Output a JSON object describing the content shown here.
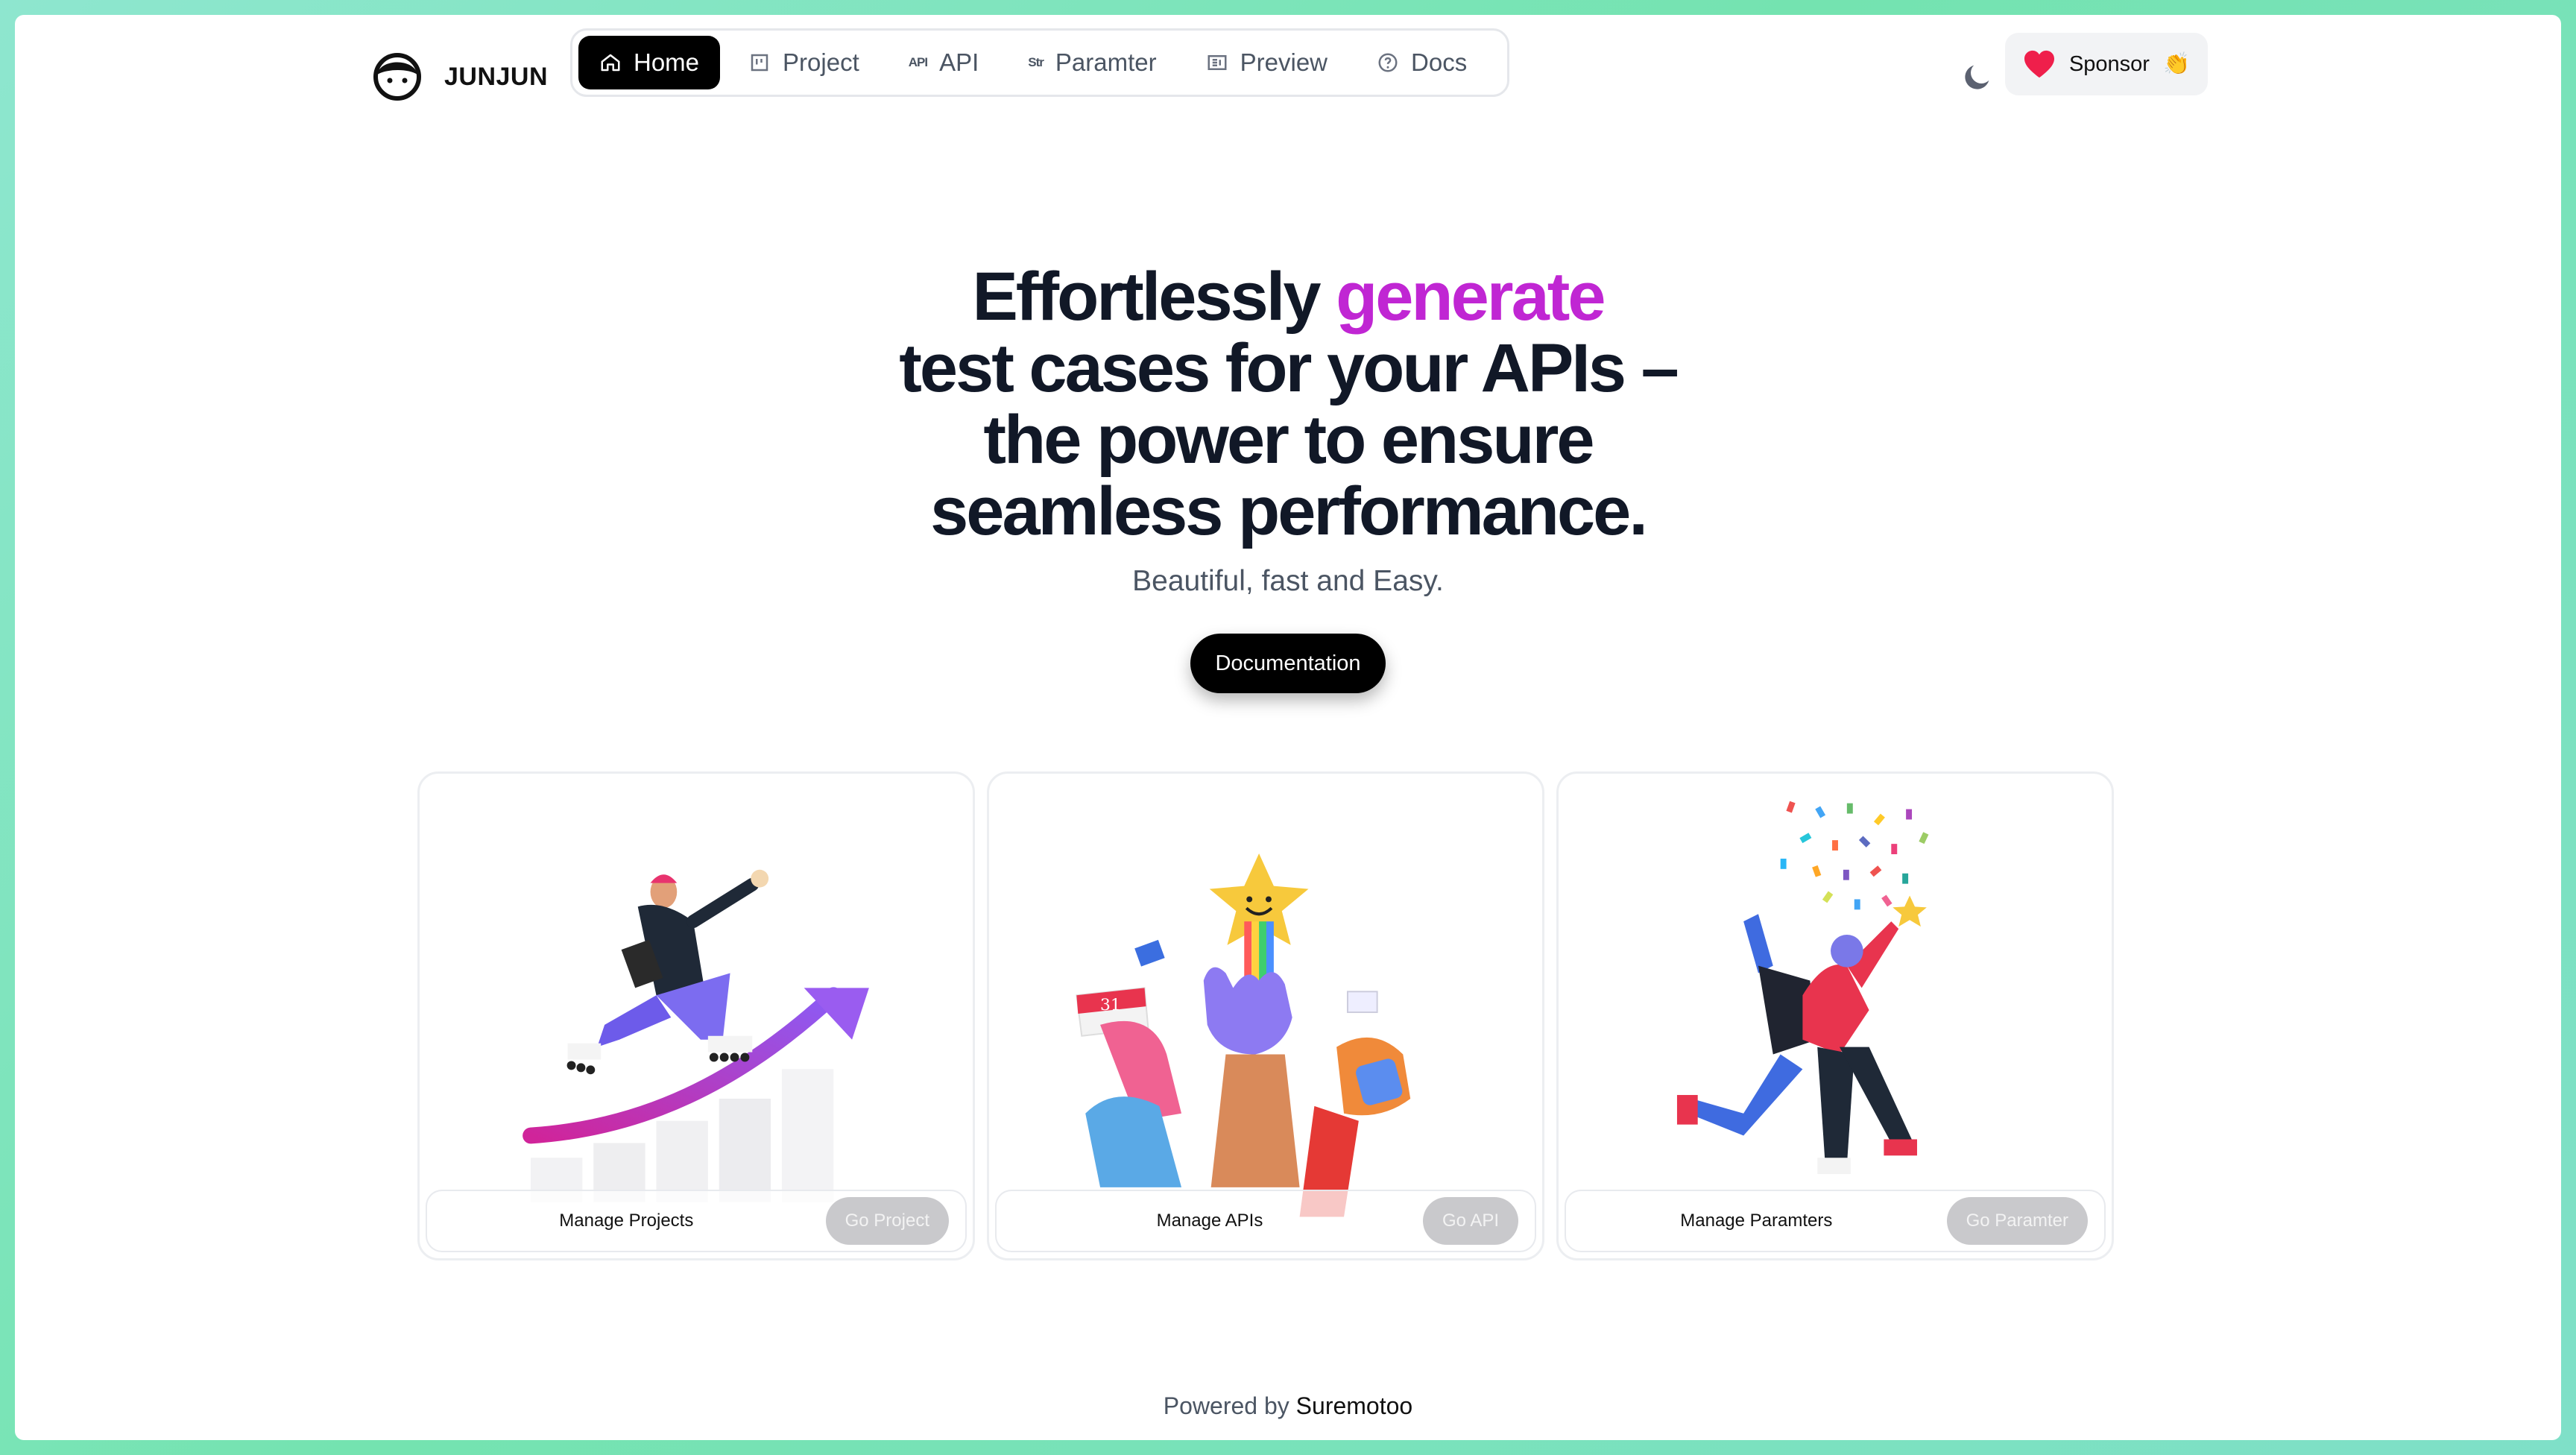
{
  "brand": {
    "name": "JUNJUN"
  },
  "nav": {
    "items": [
      {
        "label": "Home",
        "icon": "home-icon",
        "active": true
      },
      {
        "label": "Project",
        "icon": "board-icon",
        "active": false
      },
      {
        "label": "API",
        "icon": "api-icon",
        "active": false
      },
      {
        "label": "Paramter",
        "icon": "str-icon",
        "active": false
      },
      {
        "label": "Preview",
        "icon": "preview-icon",
        "active": false
      },
      {
        "label": "Docs",
        "icon": "help-circle-icon",
        "active": false
      }
    ],
    "api_glyph": "API",
    "str_glyph": "Str"
  },
  "theme_toggle": {
    "icon": "moon-icon"
  },
  "sponsor": {
    "label": "Sponsor",
    "emoji": "👏",
    "icon": "heart-icon",
    "icon_color": "#ef1f4b"
  },
  "hero": {
    "headline_pre": "Effortlessly",
    "headline_accent": "generate",
    "headline_rest_1": "test cases for your APIs –",
    "headline_rest_2": "the power to ensure",
    "headline_rest_3": "seamless performance.",
    "accent_color": "#c026d3",
    "subtitle": "Beautiful, fast and Easy.",
    "cta": "Documentation"
  },
  "cards": [
    {
      "label": "Manage Projects",
      "button": "Go Project",
      "illustration": "rollerskater-growth-illustration"
    },
    {
      "label": "Manage APIs",
      "button": "Go API",
      "illustration": "hands-star-illustration"
    },
    {
      "label": "Manage Paramters",
      "button": "Go Paramter",
      "illustration": "celebration-illustration"
    }
  ],
  "calendar_day": "31",
  "footer": {
    "prefix": "Powered by",
    "brand": "Suremotoo"
  }
}
